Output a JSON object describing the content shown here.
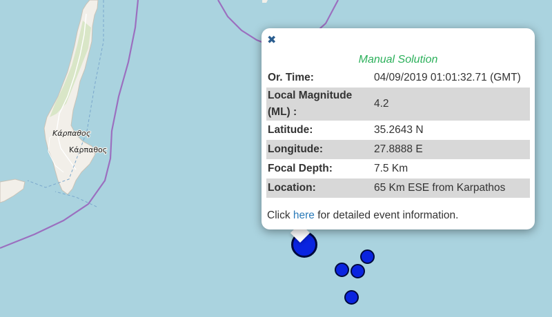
{
  "map": {
    "place_labels": [
      "Κάρπαθος",
      "Κάρπαθος"
    ]
  },
  "popup": {
    "close_symbol": "✖",
    "title": "Manual Solution",
    "title_color": "#2bb05a",
    "rows": [
      {
        "label": "Or. Time:",
        "value": "04/09/2019 01:01:32.71 (GMT)"
      },
      {
        "label": "Local Magnitude (ML) :",
        "value": "4.2"
      },
      {
        "label": "Latitude:",
        "value": "35.2643 N"
      },
      {
        "label": "Longitude:",
        "value": "27.8888 E"
      },
      {
        "label": "Focal Depth:",
        "value": "7.5 Km"
      },
      {
        "label": "Location:",
        "value": "65 Km ESE from Karpathos"
      }
    ],
    "footer": {
      "prefix": "Click",
      "link": "here",
      "suffix": "for detailed event information."
    }
  },
  "colors": {
    "sea": "#aad3df",
    "land": "#f2efe9",
    "marker_fill": "#0a24e0",
    "border_line": "#9b6fbf"
  }
}
